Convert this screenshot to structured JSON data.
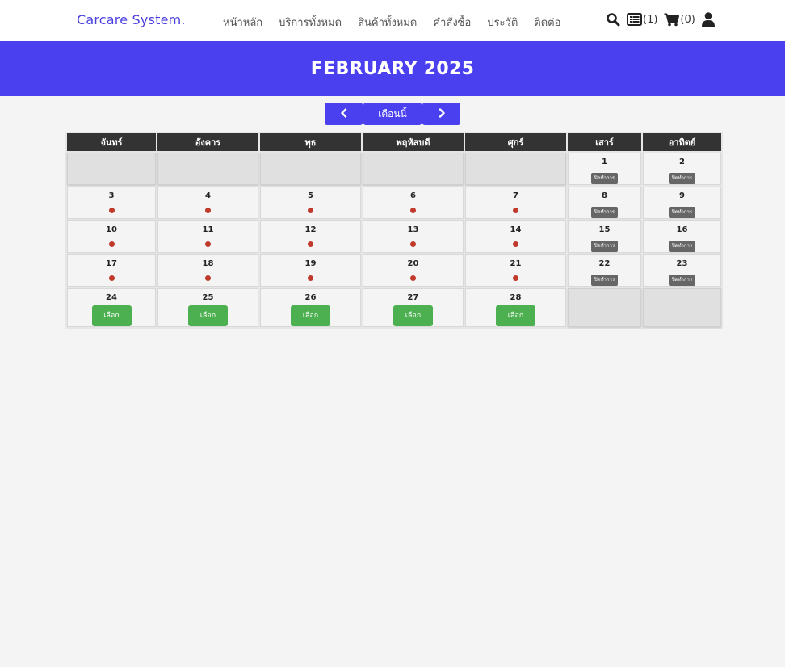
{
  "header": {
    "brand": "Carcare System.",
    "nav": [
      "หน้าหลัก",
      "บริการทั้งหมด",
      "สินค้าทั้งหมด",
      "คำสั่งซื้อ",
      "ประวัติ",
      "ติดต่อ"
    ],
    "icons": {
      "search": "search-icon",
      "list": "list-icon",
      "cart": "cart-icon",
      "user": "user-icon"
    },
    "list_count": "(1)",
    "cart_count": "(0)"
  },
  "banner": {
    "title": "FEBRUARY 2025",
    "color": "#4a40ef"
  },
  "controls": {
    "prev_icon": "chevron-left-icon",
    "today_label": "เดือนนี้",
    "next_icon": "chevron-right-icon"
  },
  "calendar": {
    "weekdays": [
      "จันทร์",
      "อังคาร",
      "พุธ",
      "พฤหัสบดี",
      "ศุกร์",
      "เสาร์",
      "อาทิตย์"
    ],
    "closed_label": "ปิดทำการ",
    "select_label": "เลือก",
    "weeks": [
      [
        {
          "day": "",
          "kind": "empty"
        },
        {
          "day": "",
          "kind": "empty"
        },
        {
          "day": "",
          "kind": "empty"
        },
        {
          "day": "",
          "kind": "empty"
        },
        {
          "day": "",
          "kind": "empty"
        },
        {
          "day": "1",
          "kind": "closed"
        },
        {
          "day": "2",
          "kind": "closed"
        }
      ],
      [
        {
          "day": "3",
          "kind": "dot"
        },
        {
          "day": "4",
          "kind": "dot"
        },
        {
          "day": "5",
          "kind": "dot"
        },
        {
          "day": "6",
          "kind": "dot"
        },
        {
          "day": "7",
          "kind": "dot"
        },
        {
          "day": "8",
          "kind": "closed"
        },
        {
          "day": "9",
          "kind": "closed"
        }
      ],
      [
        {
          "day": "10",
          "kind": "dot"
        },
        {
          "day": "11",
          "kind": "dot"
        },
        {
          "day": "12",
          "kind": "dot"
        },
        {
          "day": "13",
          "kind": "dot"
        },
        {
          "day": "14",
          "kind": "dot"
        },
        {
          "day": "15",
          "kind": "closed"
        },
        {
          "day": "16",
          "kind": "closed"
        }
      ],
      [
        {
          "day": "17",
          "kind": "dot"
        },
        {
          "day": "18",
          "kind": "dot"
        },
        {
          "day": "19",
          "kind": "dot"
        },
        {
          "day": "20",
          "kind": "dot"
        },
        {
          "day": "21",
          "kind": "dot"
        },
        {
          "day": "22",
          "kind": "closed"
        },
        {
          "day": "23",
          "kind": "closed"
        }
      ],
      [
        {
          "day": "24",
          "kind": "select"
        },
        {
          "day": "25",
          "kind": "select"
        },
        {
          "day": "26",
          "kind": "select"
        },
        {
          "day": "27",
          "kind": "select"
        },
        {
          "day": "28",
          "kind": "select"
        },
        {
          "day": "",
          "kind": "empty"
        },
        {
          "day": "",
          "kind": "empty"
        }
      ]
    ]
  },
  "colors": {
    "accent": "#4a40ef",
    "select": "#4caf50",
    "closed": "#666666",
    "dot": "#c0392b",
    "header_row": "#333333"
  }
}
